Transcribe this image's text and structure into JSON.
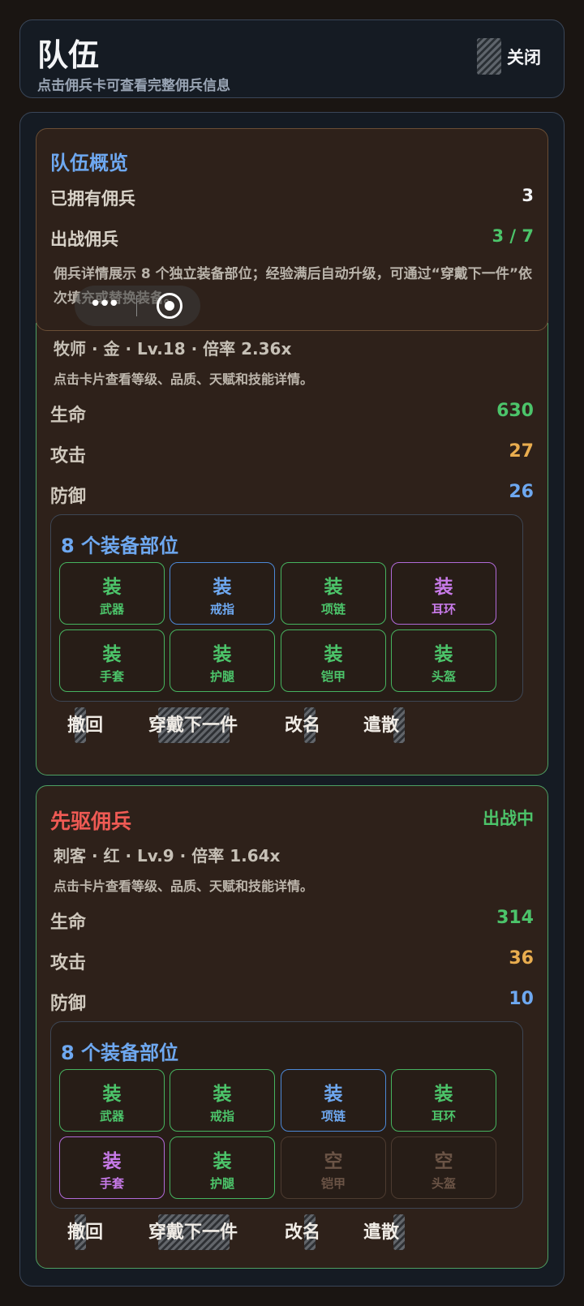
{
  "header": {
    "title": "队伍",
    "subtitle": "点击佣兵卡可查看完整佣兵信息",
    "close_label": "关闭"
  },
  "overview": {
    "title": "队伍概览",
    "owned_label": "已拥有佣兵",
    "owned_value": "3",
    "deployed_label": "出战佣兵",
    "deployed_value": "3 / 7",
    "note": "佣兵详情展示 8 个独立装备部位；经验满后自动升级，可通过“穿戴下一件”依次填充或替换装备。"
  },
  "colors": {
    "hp": "#4cc46a",
    "attack": "#e9ad4f",
    "defense": "#6ea8f0",
    "name": "#ef5a54",
    "status": "#4cc46a"
  },
  "mercenaries": [
    {
      "meta": "牧师 · 金 · Lv.18 · 倍率 2.36x",
      "hint": "点击卡片查看等级、品质、天赋和技能详情。",
      "stats": {
        "hp_label": "生命",
        "hp": "630",
        "atk_label": "攻击",
        "atk": "27",
        "def_label": "防御",
        "def": "26"
      },
      "equip_title": "8 个装备部位",
      "slots": [
        {
          "char": "装",
          "label": "武器",
          "quality": "green"
        },
        {
          "char": "装",
          "label": "戒指",
          "quality": "blue"
        },
        {
          "char": "装",
          "label": "项链",
          "quality": "green"
        },
        {
          "char": "装",
          "label": "耳环",
          "quality": "purple"
        },
        {
          "char": "装",
          "label": "手套",
          "quality": "green"
        },
        {
          "char": "装",
          "label": "护腿",
          "quality": "green"
        },
        {
          "char": "装",
          "label": "铠甲",
          "quality": "green"
        },
        {
          "char": "装",
          "label": "头盔",
          "quality": "green"
        }
      ],
      "actions": {
        "recall": "撤回",
        "equip_next": "穿戴下一件",
        "rename": "改名",
        "dismiss": "遣散"
      }
    },
    {
      "name": "先驱佣兵",
      "status": "出战中",
      "meta": "刺客 · 红 · Lv.9 · 倍率 1.64x",
      "hint": "点击卡片查看等级、品质、天赋和技能详情。",
      "stats": {
        "hp_label": "生命",
        "hp": "314",
        "atk_label": "攻击",
        "atk": "36",
        "def_label": "防御",
        "def": "10"
      },
      "equip_title": "8 个装备部位",
      "slots": [
        {
          "char": "装",
          "label": "武器",
          "quality": "green"
        },
        {
          "char": "装",
          "label": "戒指",
          "quality": "green"
        },
        {
          "char": "装",
          "label": "项链",
          "quality": "blue"
        },
        {
          "char": "装",
          "label": "耳环",
          "quality": "green"
        },
        {
          "char": "装",
          "label": "手套",
          "quality": "purple"
        },
        {
          "char": "装",
          "label": "护腿",
          "quality": "green"
        },
        {
          "char": "空",
          "label": "铠甲",
          "quality": "empty"
        },
        {
          "char": "空",
          "label": "头盔",
          "quality": "empty"
        }
      ],
      "actions": {
        "recall": "撤回",
        "equip_next": "穿戴下一件",
        "rename": "改名",
        "dismiss": "遣散"
      }
    }
  ]
}
